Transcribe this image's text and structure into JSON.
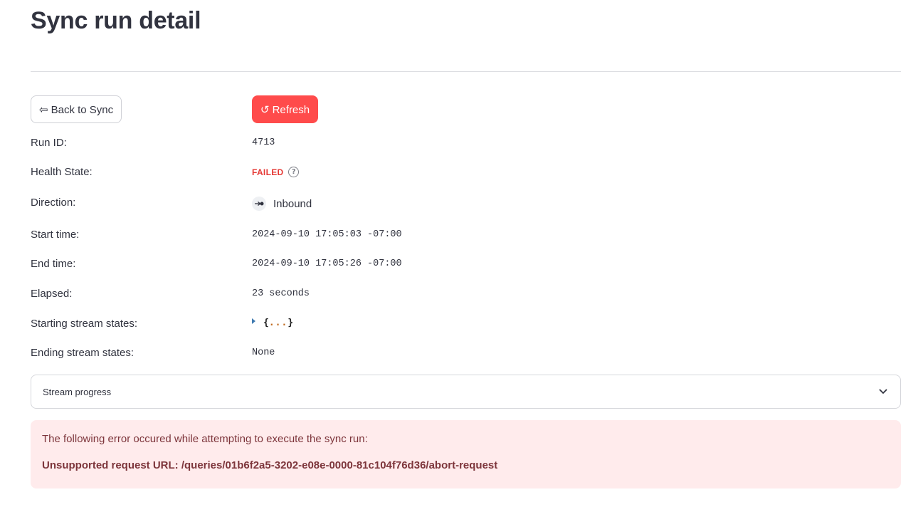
{
  "page": {
    "title": "Sync run detail"
  },
  "actions": {
    "back_label": "⇦ Back to Sync",
    "refresh_label": "↺ Refresh"
  },
  "details": {
    "run_id_label": "Run ID:",
    "run_id_value": "4713",
    "health_state_label": "Health State:",
    "health_state_value": "FAILED",
    "health_state_help": "?",
    "direction_label": "Direction:",
    "direction_value": "Inbound",
    "start_time_label": "Start time:",
    "start_time_value": "2024-09-10 17:05:03 -07:00",
    "end_time_label": "End time:",
    "end_time_value": "2024-09-10 17:05:26 -07:00",
    "elapsed_label": "Elapsed:",
    "elapsed_value": "23 seconds",
    "starting_states_label": "Starting stream states:",
    "starting_states_open": "{",
    "starting_states_dots": "...",
    "starting_states_close": "}",
    "ending_states_label": "Ending stream states:",
    "ending_states_value": "None"
  },
  "stream_progress": {
    "label": "Stream progress"
  },
  "error": {
    "intro": "The following error occured while attempting to execute the sync run:",
    "message": "Unsupported request URL: /queries/01b6f2a5-3202-e08e-0000-81c104f76d36/abort-request"
  },
  "colors": {
    "primary": "#ff4b4b",
    "failed": "#e53935",
    "error_bg": "#ffebec",
    "error_text": "#7d353b"
  },
  "icons": {
    "help": "help-circle-icon",
    "direction": "inbound-arrow-icon",
    "expand": "chevron-down-icon",
    "json_toggle": "caret-right-icon"
  }
}
